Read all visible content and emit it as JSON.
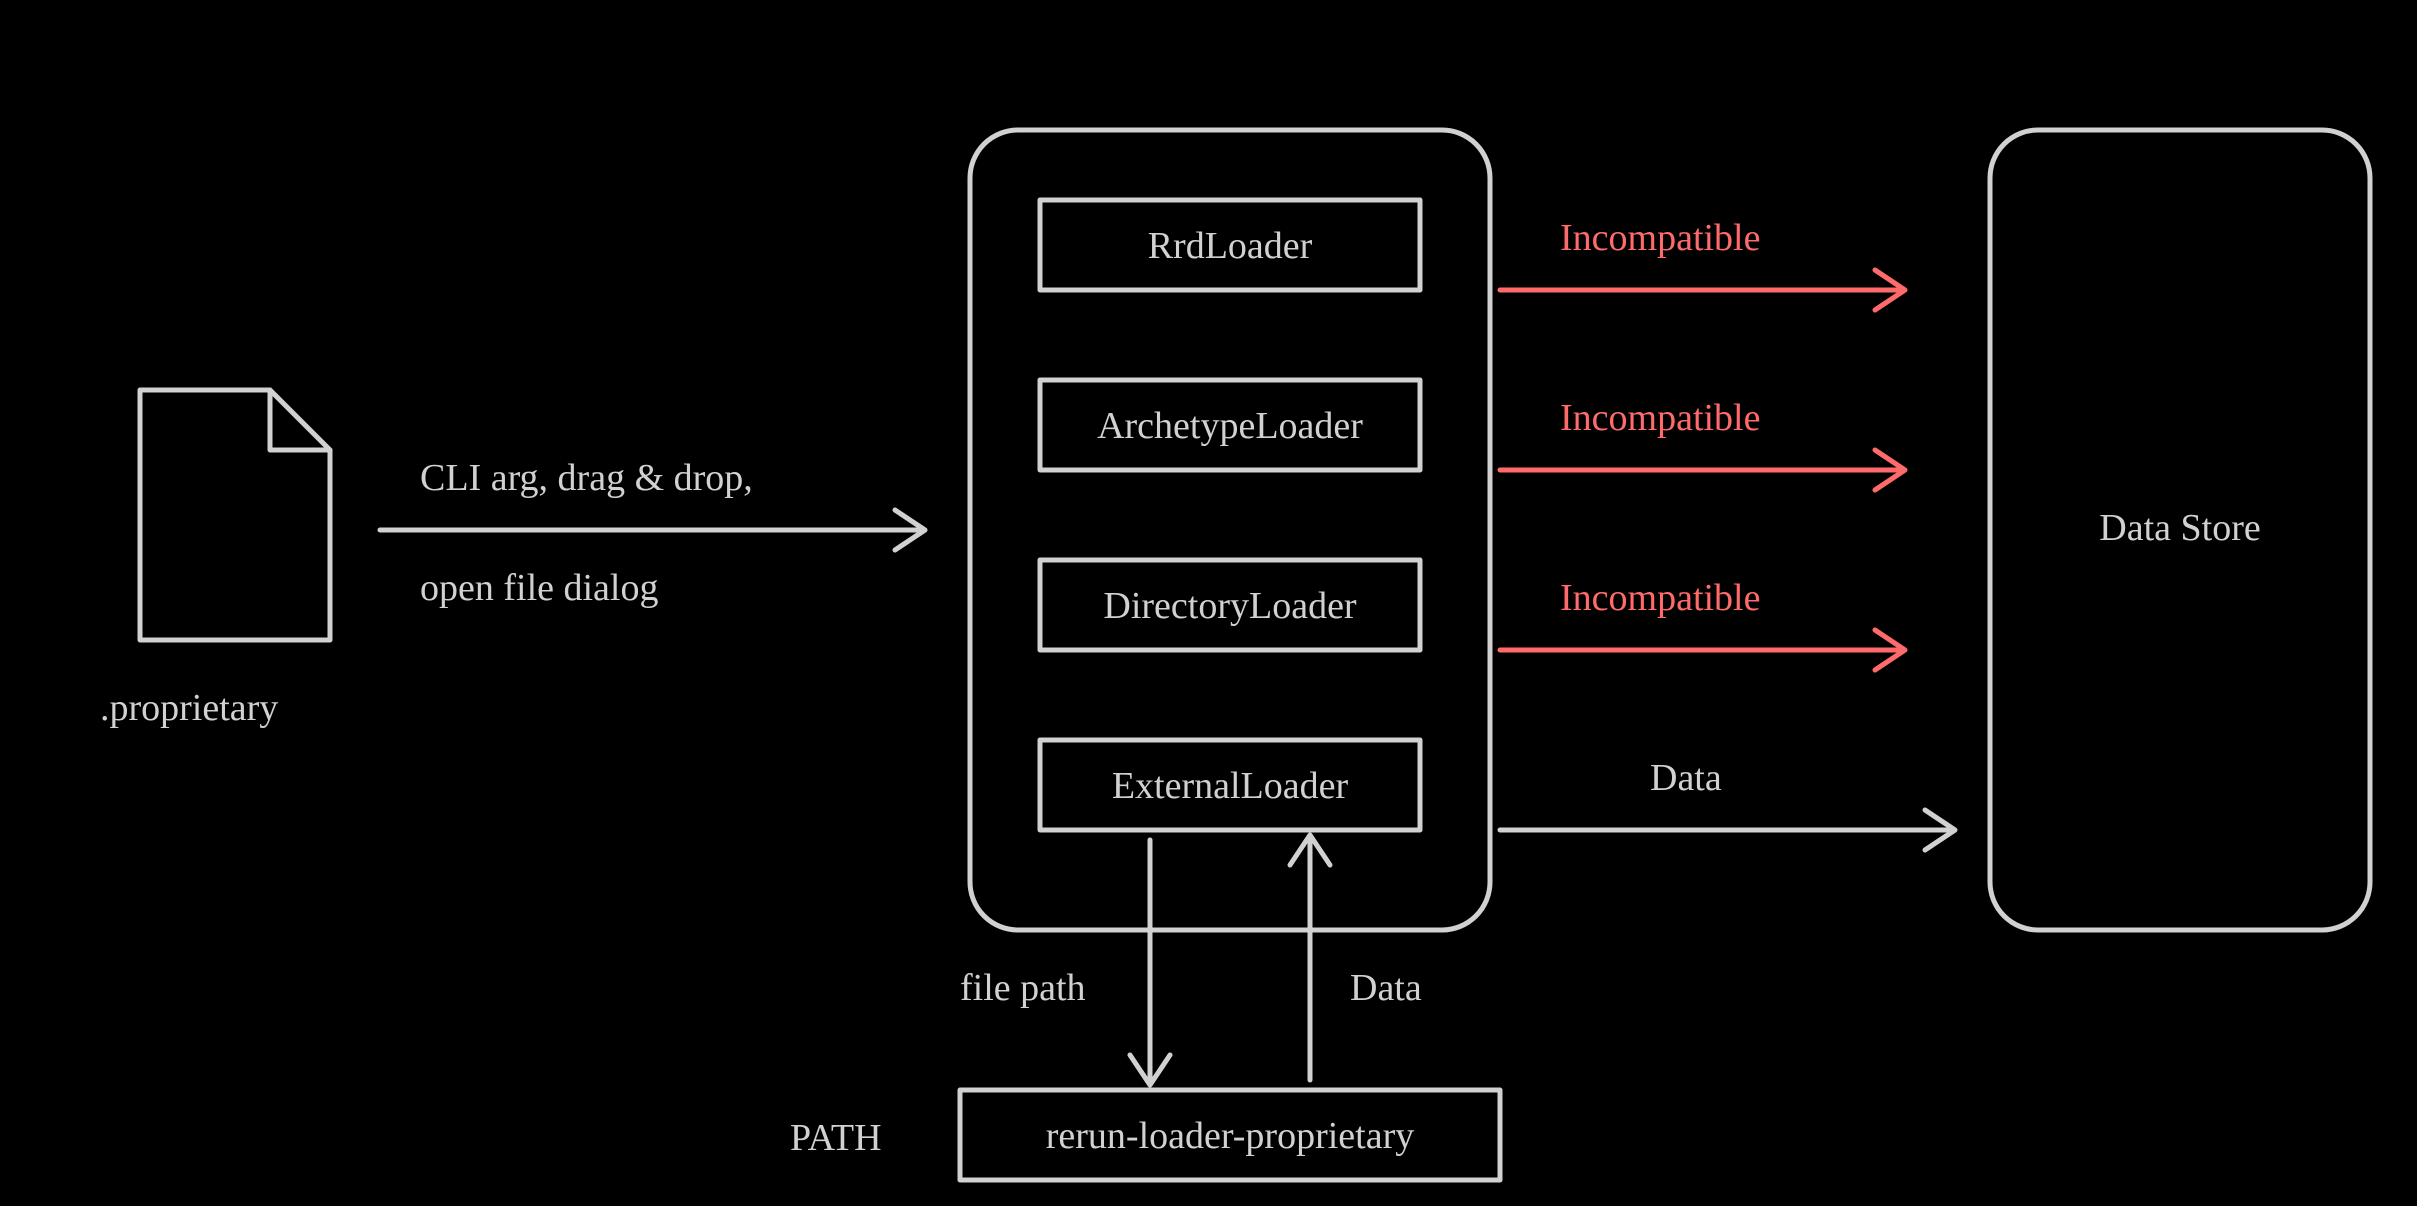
{
  "colors": {
    "fg": "#d1d1d1",
    "error": "#ff6b6b",
    "bg": "#000000"
  },
  "file": {
    "extension": ".proprietary"
  },
  "input_arrow": {
    "label1": "CLI arg, drag & drop,",
    "label2": "open file dialog"
  },
  "loaders_box": {
    "items": [
      {
        "name": "RrdLoader",
        "result": "Incompatible",
        "status": "error"
      },
      {
        "name": "ArchetypeLoader",
        "result": "Incompatible",
        "status": "error"
      },
      {
        "name": "DirectoryLoader",
        "result": "Incompatible",
        "status": "error"
      },
      {
        "name": "ExternalLoader",
        "result": "Data",
        "status": "ok"
      }
    ]
  },
  "data_store": {
    "label": "Data Store"
  },
  "external": {
    "down_label": "file path",
    "up_label": "Data",
    "path_label": "PATH",
    "binary": "rerun-loader-proprietary"
  }
}
